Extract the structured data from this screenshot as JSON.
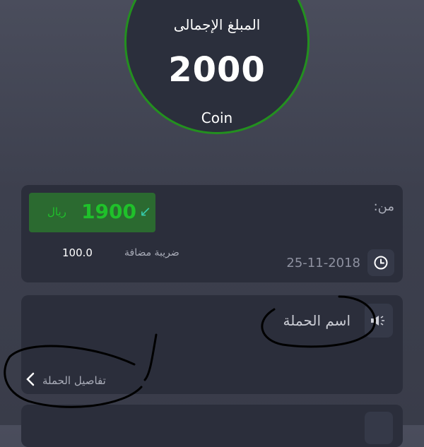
{
  "total": {
    "label": "المبلغ الإجمالى",
    "amount": "2000",
    "unit": "Coin"
  },
  "transaction": {
    "from_label": "من:",
    "amount": "1900",
    "currency": "ريال",
    "tax_label": "ضريبة مضافة",
    "tax_value": "100.0",
    "date": "25-11-2018"
  },
  "campaign": {
    "name": "اسم الحملة",
    "details_label": "تفاصيل الحملة"
  },
  "icons": [
    "clock-icon",
    "megaphone-icon",
    "arrow-down-left-icon",
    "chevron-left-icon"
  ],
  "colors": {
    "accent_green": "#1fc12a",
    "ring_green": "#23901f",
    "card_bg": "#2b2e3b"
  }
}
